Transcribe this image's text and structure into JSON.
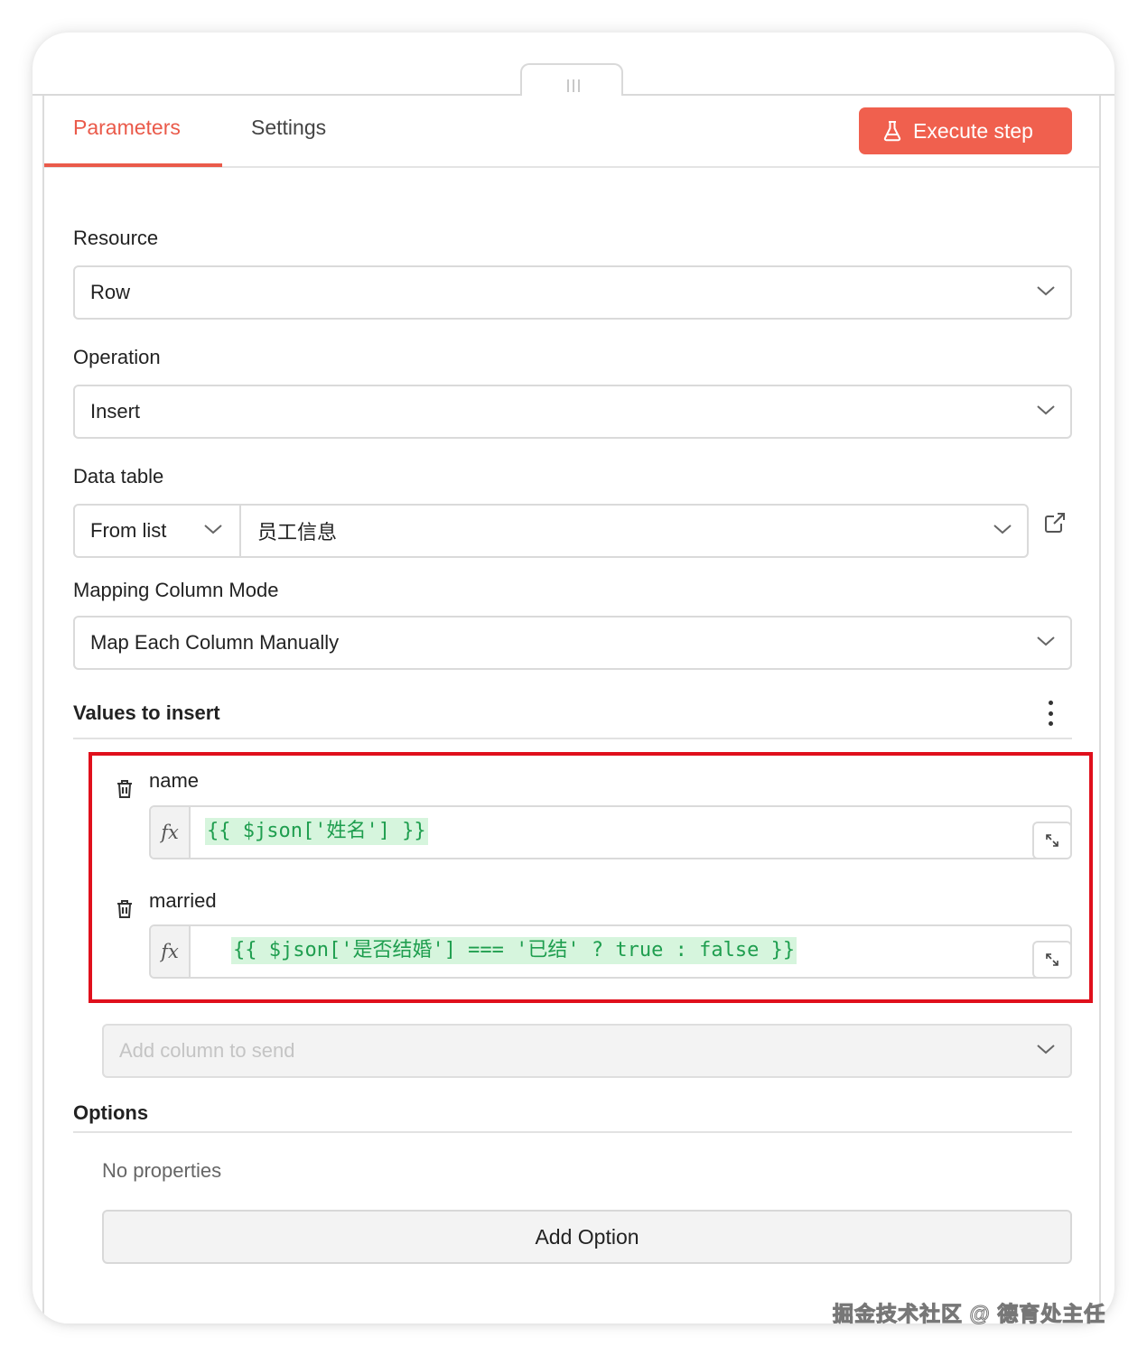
{
  "tabs": {
    "parameters": "Parameters",
    "settings": "Settings"
  },
  "execute_label": "Execute step",
  "resource": {
    "label": "Resource",
    "value": "Row"
  },
  "operation": {
    "label": "Operation",
    "value": "Insert"
  },
  "data_table": {
    "label": "Data table",
    "mode": "From list",
    "value": "员工信息"
  },
  "mapping_mode": {
    "label": "Mapping Column Mode",
    "value": "Map Each Column Manually"
  },
  "values_section": {
    "title": "Values to insert",
    "fields": [
      {
        "name": "name",
        "expression": "{{ $json['姓名'] }}"
      },
      {
        "name": "married",
        "expression": "{{ $json['是否结婚'] === '已结' ? true : false }}"
      }
    ],
    "fx_label": "fx"
  },
  "add_column_placeholder": "Add column to send",
  "options": {
    "title": "Options",
    "empty_text": "No properties",
    "add_label": "Add Option"
  },
  "watermark": "掘金技术社区 @ 德育处主任",
  "colors": {
    "accent": "#f0604e",
    "highlight": "#e0101c",
    "code_text": "#1f9e4f",
    "code_bg": "#d6f5dd"
  }
}
